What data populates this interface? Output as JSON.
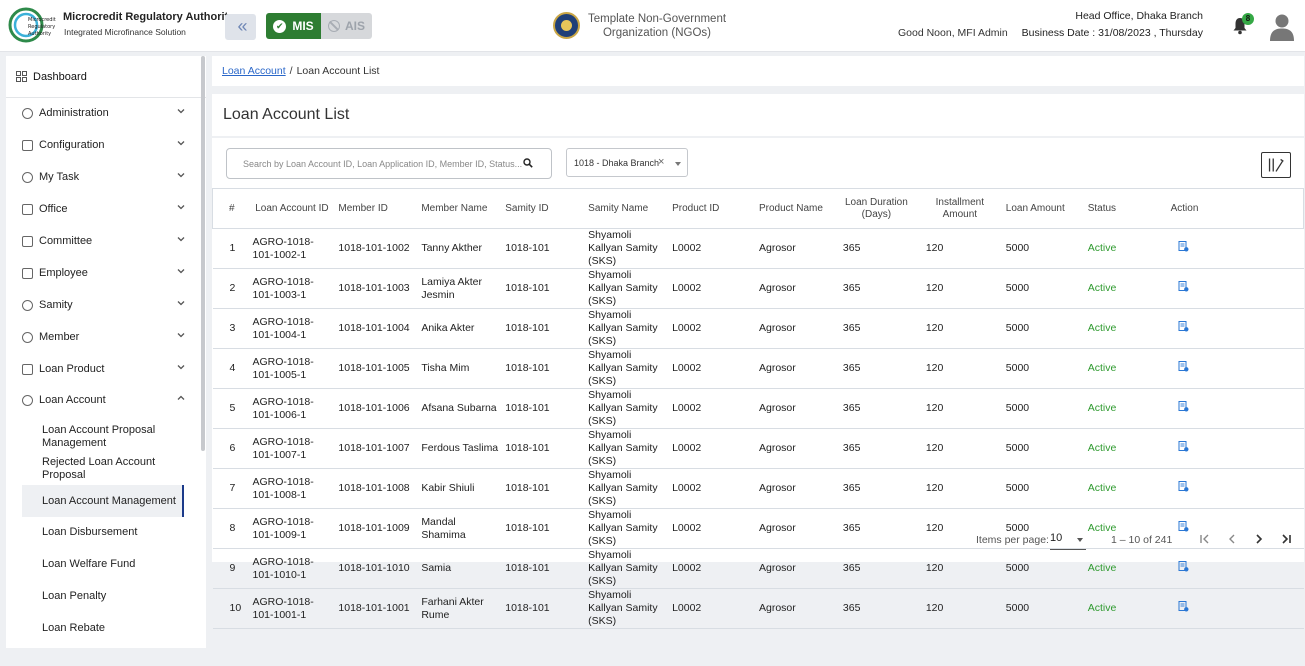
{
  "header": {
    "logo_text": [
      "Microcredit",
      "Regulatory",
      "Authority"
    ],
    "org_title": "Microcredit Regulatory Authority",
    "org_subtitle": "Integrated Microfinance Solution",
    "module_mis": "MIS",
    "module_ais": "AIS",
    "ngo_name": "Template Non-Government Organization (NGOs)",
    "greeting": "Good Noon, MFI Admin",
    "branch": "Head Office, Dhaka Branch",
    "business_date": "Business Date : 31/08/2023 , Thursday",
    "notification_count": "8",
    "colors": {
      "mis_green": "#2e7d32",
      "accent_blue": "#1b3a8a"
    }
  },
  "sidebar": {
    "dashboard": "Dashboard",
    "items": [
      {
        "label": "Administration",
        "icon": "admin-icon"
      },
      {
        "label": "Configuration",
        "icon": "config-icon"
      },
      {
        "label": "My Task",
        "icon": "task-icon"
      },
      {
        "label": "Office",
        "icon": "office-icon"
      },
      {
        "label": "Committee",
        "icon": "committee-icon"
      },
      {
        "label": "Employee",
        "icon": "employee-icon"
      },
      {
        "label": "Samity",
        "icon": "samity-icon"
      },
      {
        "label": "Member",
        "icon": "member-icon"
      },
      {
        "label": "Loan Product",
        "icon": "loan-product-icon"
      },
      {
        "label": "Loan Account",
        "icon": "loan-account-icon"
      }
    ],
    "sub_items": [
      "Loan Account Proposal Management",
      "Rejected Loan Account Proposal",
      "Loan Account Management",
      "Loan Disbursement",
      "Loan Welfare Fund",
      "Loan Penalty",
      "Loan Rebate"
    ]
  },
  "breadcrumb": {
    "link": "Loan Account",
    "separator": "/",
    "current": "Loan Account List"
  },
  "page_title": "Loan Account List",
  "filters": {
    "search_placeholder": "Search by Loan Account ID, Loan Application ID, Member ID, Status...",
    "branch_value": "1018 - Dhaka Branch"
  },
  "table": {
    "headers": [
      "#",
      "Loan Account ID",
      "Member ID",
      "Member Name",
      "Samity ID",
      "Samity Name",
      "Product ID",
      "Product Name",
      "Loan Duration (Days)",
      "Installment Amount",
      "Loan Amount",
      "Status",
      "Action"
    ],
    "rows": [
      [
        "1",
        "AGRO-1018-101-1002-1",
        "1018-101-1002",
        "Tanny Akther",
        "1018-101",
        "Shyamoli Kallyan Samity (SKS)",
        "L0002",
        "Agrosor",
        "365",
        "120",
        "5000",
        "Active"
      ],
      [
        "2",
        "AGRO-1018-101-1003-1",
        "1018-101-1003",
        "Lamiya Akter Jesmin",
        "1018-101",
        "Shyamoli Kallyan Samity (SKS)",
        "L0002",
        "Agrosor",
        "365",
        "120",
        "5000",
        "Active"
      ],
      [
        "3",
        "AGRO-1018-101-1004-1",
        "1018-101-1004",
        "Anika Akter",
        "1018-101",
        "Shyamoli Kallyan Samity (SKS)",
        "L0002",
        "Agrosor",
        "365",
        "120",
        "5000",
        "Active"
      ],
      [
        "4",
        "AGRO-1018-101-1005-1",
        "1018-101-1005",
        "Tisha Mim",
        "1018-101",
        "Shyamoli Kallyan Samity (SKS)",
        "L0002",
        "Agrosor",
        "365",
        "120",
        "5000",
        "Active"
      ],
      [
        "5",
        "AGRO-1018-101-1006-1",
        "1018-101-1006",
        "Afsana Subarna",
        "1018-101",
        "Shyamoli Kallyan Samity (SKS)",
        "L0002",
        "Agrosor",
        "365",
        "120",
        "5000",
        "Active"
      ],
      [
        "6",
        "AGRO-1018-101-1007-1",
        "1018-101-1007",
        "Ferdous Taslima",
        "1018-101",
        "Shyamoli Kallyan Samity (SKS)",
        "L0002",
        "Agrosor",
        "365",
        "120",
        "5000",
        "Active"
      ],
      [
        "7",
        "AGRO-1018-101-1008-1",
        "1018-101-1008",
        "Kabir Shiuli",
        "1018-101",
        "Shyamoli Kallyan Samity (SKS)",
        "L0002",
        "Agrosor",
        "365",
        "120",
        "5000",
        "Active"
      ],
      [
        "8",
        "AGRO-1018-101-1009-1",
        "1018-101-1009",
        "Mandal Shamima",
        "1018-101",
        "Shyamoli Kallyan Samity (SKS)",
        "L0002",
        "Agrosor",
        "365",
        "120",
        "5000",
        "Active"
      ],
      [
        "9",
        "AGRO-1018-101-1010-1",
        "1018-101-1010",
        "Samia",
        "1018-101",
        "Shyamoli Kallyan Samity (SKS)",
        "L0002",
        "Agrosor",
        "365",
        "120",
        "5000",
        "Active"
      ],
      [
        "10",
        "AGRO-1018-101-1001-1",
        "1018-101-1001",
        "Farhani Akter Rume",
        "1018-101",
        "Shyamoli Kallyan Samity (SKS)",
        "L0002",
        "Agrosor",
        "365",
        "120",
        "5000",
        "Active"
      ]
    ]
  },
  "paginator": {
    "items_per_page_label": "Items per page:",
    "items_per_page": "10",
    "range": "1 – 10 of 241"
  }
}
